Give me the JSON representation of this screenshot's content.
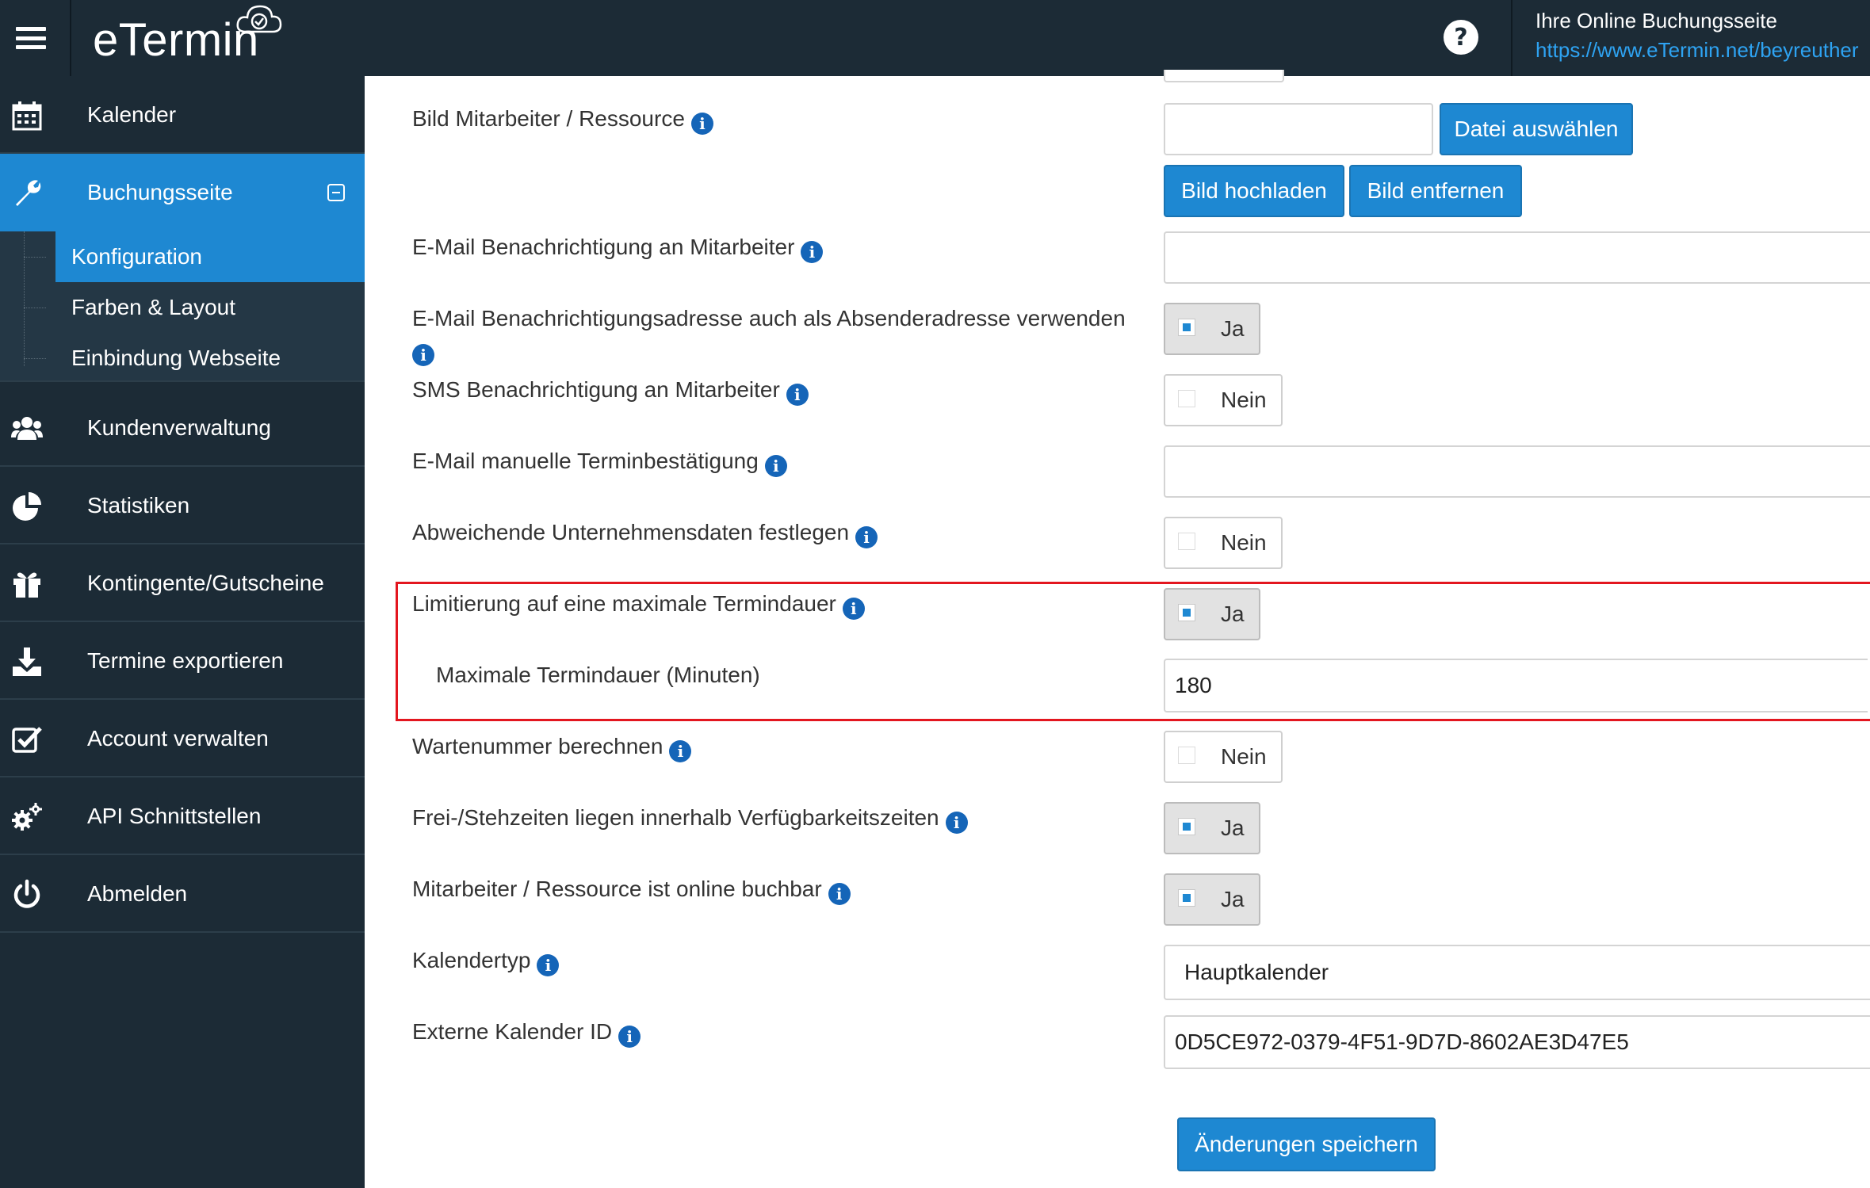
{
  "header": {
    "logo_text": "eTermin",
    "booking_title": "Ihre Online Buchungsseite",
    "booking_url": "https://www.eTermin.net/beyreuther"
  },
  "sidebar": {
    "items": [
      {
        "label": "Kalender",
        "icon": "calendar-icon"
      },
      {
        "label": "Buchungsseite",
        "icon": "wrench-icon",
        "active": true
      },
      {
        "label": "Kundenverwaltung",
        "icon": "users-icon"
      },
      {
        "label": "Statistiken",
        "icon": "pie-chart-icon"
      },
      {
        "label": "Kontingente/Gutscheine",
        "icon": "gift-icon"
      },
      {
        "label": "Termine exportieren",
        "icon": "download-icon"
      },
      {
        "label": "Account verwalten",
        "icon": "checkbox-icon"
      },
      {
        "label": "API Schnittstellen",
        "icon": "gears-icon"
      },
      {
        "label": "Abmelden",
        "icon": "power-icon"
      }
    ],
    "subitems": [
      {
        "label": "Konfiguration",
        "active": true
      },
      {
        "label": "Farben & Layout"
      },
      {
        "label": "Einbindung Webseite"
      }
    ]
  },
  "form": {
    "bild": {
      "label": "Bild Mitarbeiter / Ressource",
      "file_value": "",
      "choose_button": "Datei auswählen",
      "upload_button": "Bild hochladen",
      "remove_button": "Bild entfernen"
    },
    "email_notify": {
      "label": "E-Mail Benachrichtigung an Mitarbeiter",
      "value": ""
    },
    "email_sender": {
      "label": "E-Mail Benachrichtigungsadresse auch als Absenderadresse verwenden",
      "state": "Ja"
    },
    "sms_notify": {
      "label": "SMS Benachrichtigung an Mitarbeiter",
      "state": "Nein"
    },
    "email_manual": {
      "label": "E-Mail manuelle Terminbestätigung",
      "value": ""
    },
    "company_data": {
      "label": "Abweichende Unternehmensdaten festlegen",
      "state": "Nein"
    },
    "limit_duration": {
      "label": "Limitierung auf eine maximale Termindauer",
      "state": "Ja"
    },
    "max_duration": {
      "label": "Maximale Termindauer (Minuten)",
      "value": "180"
    },
    "waiting_number": {
      "label": "Wartenummer berechnen",
      "state": "Nein"
    },
    "free_times": {
      "label": "Frei-/Stehzeiten liegen innerhalb Verfügbarkeitszeiten",
      "state": "Ja"
    },
    "online_bookable": {
      "label": "Mitarbeiter / Ressource ist online buchbar",
      "state": "Ja"
    },
    "calendar_type": {
      "label": "Kalendertyp",
      "value": "Hauptkalender"
    },
    "external_id": {
      "label": "Externe Kalender ID",
      "value": "0D5CE972-0379-4F51-9D7D-8602AE3D47E5"
    },
    "save_button": "Änderungen speichern"
  },
  "colors": {
    "sidebar_bg": "#1c2b36",
    "accent": "#1e88d2",
    "highlight": "#e3161f",
    "link": "#2ea3f2"
  }
}
